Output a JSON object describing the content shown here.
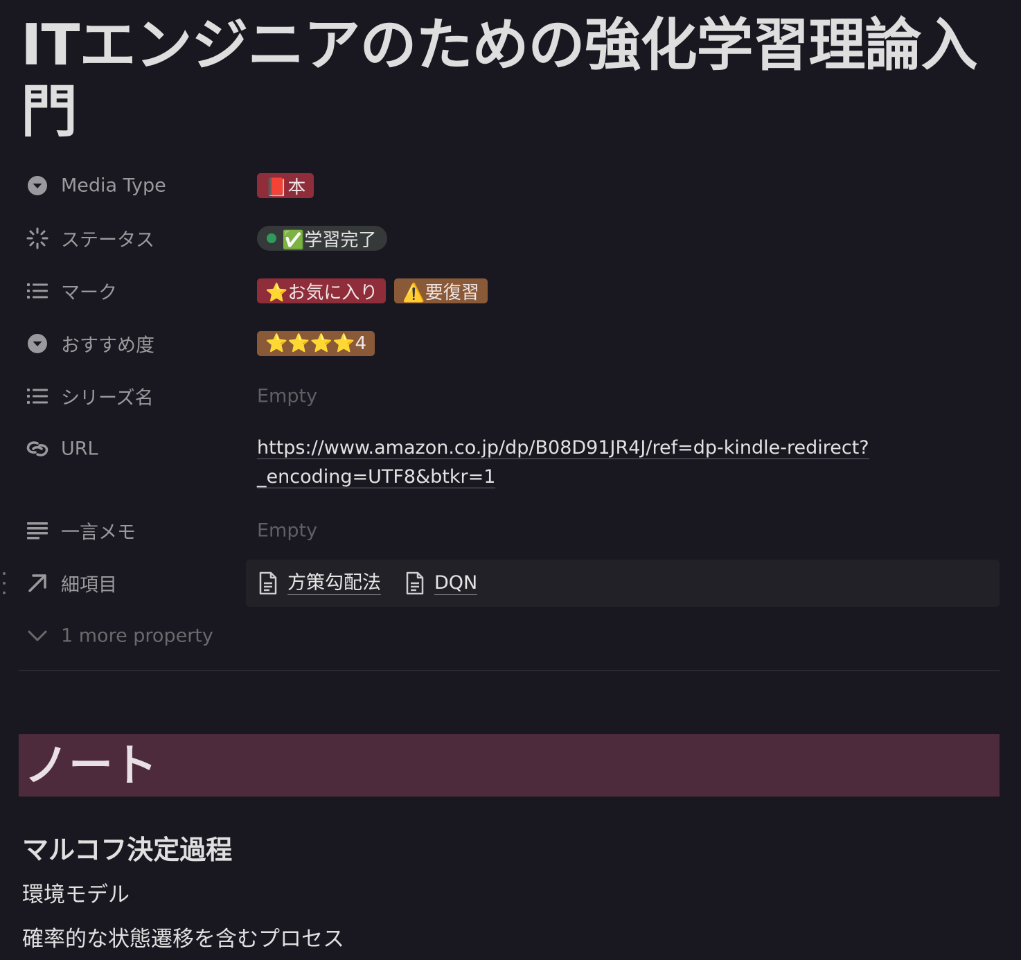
{
  "page": {
    "title": "ITエンジニアのための強化学習理論入門"
  },
  "properties": {
    "media_type": {
      "label": "Media Type",
      "icon": "select-icon",
      "value": "📕本"
    },
    "status": {
      "label": "ステータス",
      "icon": "status-icon",
      "value": "✅学習完了",
      "dot_color": "#2f9a5c"
    },
    "mark": {
      "label": "マーク",
      "icon": "list-icon",
      "values": [
        "⭐お気に入り",
        "⚠️要復習"
      ]
    },
    "recommend": {
      "label": "おすすめ度",
      "icon": "select-icon",
      "value": "⭐⭐⭐⭐4"
    },
    "series": {
      "label": "シリーズ名",
      "icon": "list-icon",
      "value": "Empty"
    },
    "url": {
      "label": "URL",
      "icon": "link-icon",
      "line1": "https://www.amazon.co.jp/dp/B08D91JR4J/ref=dp-kindle-redirect?",
      "line2": "_encoding=UTF8&btkr=1"
    },
    "memo": {
      "label": "一言メモ",
      "icon": "text-icon",
      "value": "Empty"
    },
    "details": {
      "label": "細項目",
      "icon": "relation-arrow-icon",
      "items": [
        "方策勾配法",
        "DQN"
      ]
    },
    "more": {
      "label": "1 more property",
      "icon": "chevron-down-icon"
    }
  },
  "colors": {
    "background": "#191820",
    "tag_red": "#8f2d3a",
    "tag_brown": "#8a5a38",
    "banner": "#4d2b3c"
  },
  "content": {
    "banner_heading": "ノート",
    "subheading": "マルコフ決定過程",
    "paragraphs": [
      "環境モデル",
      "確率的な状態遷移を含むプロセス"
    ]
  }
}
